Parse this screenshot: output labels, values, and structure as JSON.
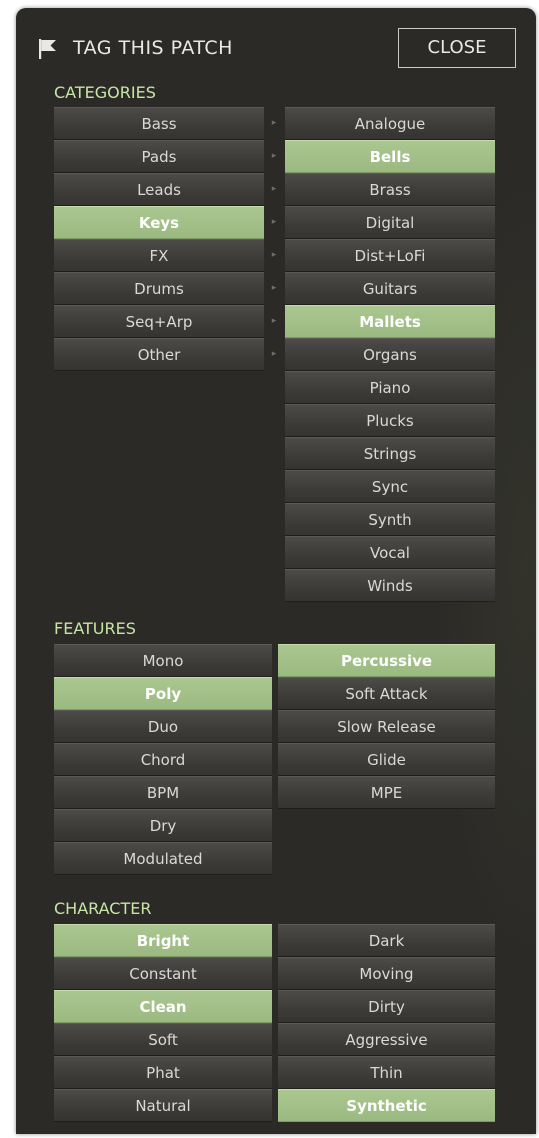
{
  "header": {
    "title": "TAG THIS PATCH",
    "close_label": "CLOSE"
  },
  "icons": {
    "flag": "flag-icon",
    "arrow": "chevron-right-icon"
  },
  "colors": {
    "accent": "#a5c28a",
    "background": "#2c2a27",
    "section_label": "#c7e6a6"
  },
  "categories": {
    "label": "CATEGORIES",
    "main": [
      {
        "label": "Bass",
        "selected": false
      },
      {
        "label": "Pads",
        "selected": false
      },
      {
        "label": "Leads",
        "selected": false
      },
      {
        "label": "Keys",
        "selected": true
      },
      {
        "label": "FX",
        "selected": false
      },
      {
        "label": "Drums",
        "selected": false
      },
      {
        "label": "Seq+Arp",
        "selected": false
      },
      {
        "label": "Other",
        "selected": false
      }
    ],
    "sub": [
      {
        "label": "Analogue",
        "selected": false
      },
      {
        "label": "Bells",
        "selected": true
      },
      {
        "label": "Brass",
        "selected": false
      },
      {
        "label": "Digital",
        "selected": false
      },
      {
        "label": "Dist+LoFi",
        "selected": false
      },
      {
        "label": "Guitars",
        "selected": false
      },
      {
        "label": "Mallets",
        "selected": true
      },
      {
        "label": "Organs",
        "selected": false
      },
      {
        "label": "Piano",
        "selected": false
      },
      {
        "label": "Plucks",
        "selected": false
      },
      {
        "label": "Strings",
        "selected": false
      },
      {
        "label": "Sync",
        "selected": false
      },
      {
        "label": "Synth",
        "selected": false
      },
      {
        "label": "Vocal",
        "selected": false
      },
      {
        "label": "Winds",
        "selected": false
      }
    ]
  },
  "features": {
    "label": "FEATURES",
    "left": [
      {
        "label": "Mono",
        "selected": false
      },
      {
        "label": "Poly",
        "selected": true
      },
      {
        "label": "Duo",
        "selected": false
      },
      {
        "label": "Chord",
        "selected": false
      },
      {
        "label": "BPM",
        "selected": false
      },
      {
        "label": "Dry",
        "selected": false
      },
      {
        "label": "Modulated",
        "selected": false
      }
    ],
    "right": [
      {
        "label": "Percussive",
        "selected": true
      },
      {
        "label": "Soft Attack",
        "selected": false
      },
      {
        "label": "Slow Release",
        "selected": false
      },
      {
        "label": "Glide",
        "selected": false
      },
      {
        "label": "MPE",
        "selected": false
      }
    ]
  },
  "character": {
    "label": "CHARACTER",
    "left": [
      {
        "label": "Bright",
        "selected": true
      },
      {
        "label": "Constant",
        "selected": false
      },
      {
        "label": "Clean",
        "selected": true
      },
      {
        "label": "Soft",
        "selected": false
      },
      {
        "label": "Phat",
        "selected": false
      },
      {
        "label": "Natural",
        "selected": false
      }
    ],
    "right": [
      {
        "label": "Dark",
        "selected": false
      },
      {
        "label": "Moving",
        "selected": false
      },
      {
        "label": "Dirty",
        "selected": false
      },
      {
        "label": "Aggressive",
        "selected": false
      },
      {
        "label": "Thin",
        "selected": false
      },
      {
        "label": "Synthetic",
        "selected": true
      }
    ]
  }
}
